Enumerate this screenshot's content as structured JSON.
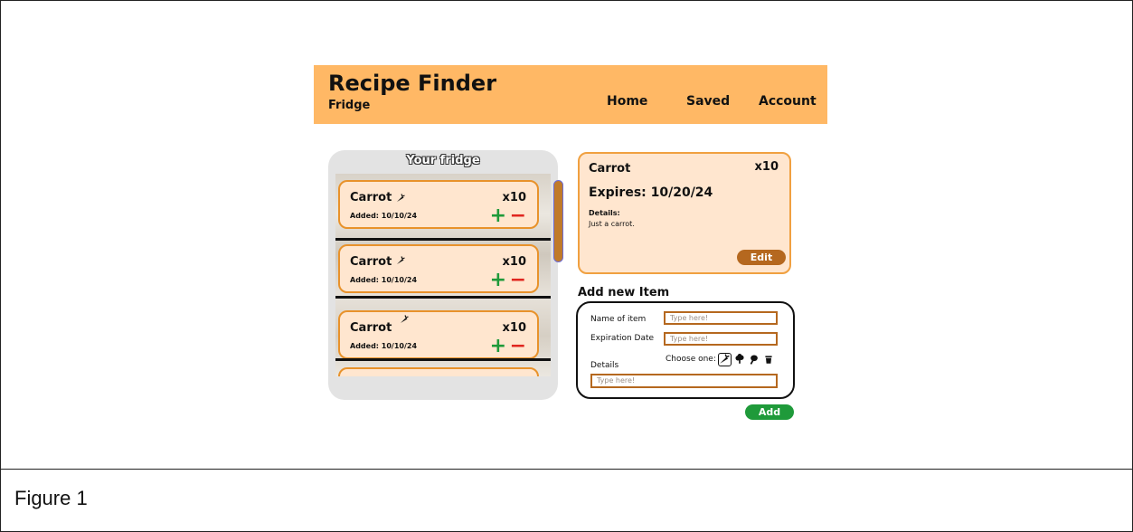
{
  "header": {
    "title": "Recipe Finder",
    "subtitle": "Fridge",
    "nav": [
      "Home",
      "Saved",
      "Account"
    ]
  },
  "fridge": {
    "title": "Your fridge",
    "items": [
      {
        "name": "Carrot",
        "qty": "x10",
        "added": "Added: 10/10/24",
        "icon": "carrot-icon"
      },
      {
        "name": "Carrot",
        "qty": "x10",
        "added": "Added: 10/10/24",
        "icon": "carrot-icon"
      },
      {
        "name": "Carrot",
        "qty": "x10",
        "added": "Added: 10/10/24",
        "icon": "carrot-icon"
      }
    ],
    "plus": "+",
    "minus": "−"
  },
  "detail": {
    "name": "Carrot",
    "qty": "x10",
    "expires": "Expires: 10/20/24",
    "details_label": "Details:",
    "details_text": "Just a carrot.",
    "edit_label": "Edit"
  },
  "add_item": {
    "title": "Add new Item",
    "name_label": "Name of item",
    "name_placeholder": "Type here!",
    "date_label": "Expiration Date",
    "date_placeholder": "Type here!",
    "choose_label": "Choose one:",
    "choices": [
      "carrot-icon",
      "broccoli-icon",
      "meat-icon",
      "drink-icon"
    ],
    "details_label": "Details",
    "details_placeholder": "Type here!",
    "add_label": "Add"
  },
  "colors": {
    "header_bg": "#ffb865",
    "card_bg": "#ffe6cf",
    "card_border": "#e8922b",
    "edit_button": "#b5681f",
    "add_button": "#1f9a3a",
    "minus": "#e0261f"
  },
  "caption": "Figure 1"
}
